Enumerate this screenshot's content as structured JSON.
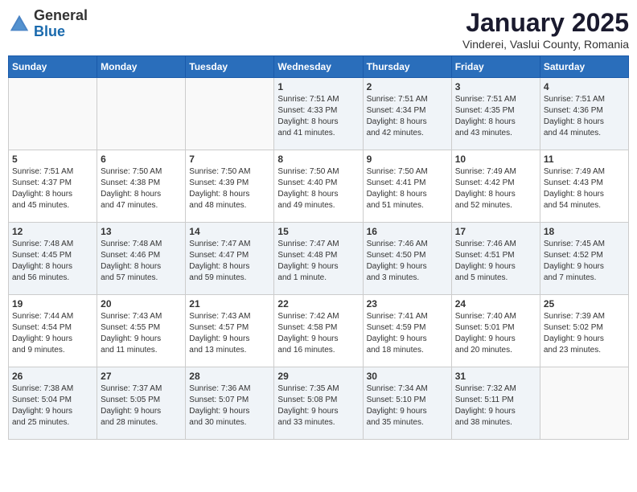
{
  "header": {
    "logo_general": "General",
    "logo_blue": "Blue",
    "title": "January 2025",
    "location": "Vinderei, Vaslui County, Romania"
  },
  "weekdays": [
    "Sunday",
    "Monday",
    "Tuesday",
    "Wednesday",
    "Thursday",
    "Friday",
    "Saturday"
  ],
  "weeks": [
    [
      {
        "day": "",
        "info": ""
      },
      {
        "day": "",
        "info": ""
      },
      {
        "day": "",
        "info": ""
      },
      {
        "day": "1",
        "info": "Sunrise: 7:51 AM\nSunset: 4:33 PM\nDaylight: 8 hours\nand 41 minutes."
      },
      {
        "day": "2",
        "info": "Sunrise: 7:51 AM\nSunset: 4:34 PM\nDaylight: 8 hours\nand 42 minutes."
      },
      {
        "day": "3",
        "info": "Sunrise: 7:51 AM\nSunset: 4:35 PM\nDaylight: 8 hours\nand 43 minutes."
      },
      {
        "day": "4",
        "info": "Sunrise: 7:51 AM\nSunset: 4:36 PM\nDaylight: 8 hours\nand 44 minutes."
      }
    ],
    [
      {
        "day": "5",
        "info": "Sunrise: 7:51 AM\nSunset: 4:37 PM\nDaylight: 8 hours\nand 45 minutes."
      },
      {
        "day": "6",
        "info": "Sunrise: 7:50 AM\nSunset: 4:38 PM\nDaylight: 8 hours\nand 47 minutes."
      },
      {
        "day": "7",
        "info": "Sunrise: 7:50 AM\nSunset: 4:39 PM\nDaylight: 8 hours\nand 48 minutes."
      },
      {
        "day": "8",
        "info": "Sunrise: 7:50 AM\nSunset: 4:40 PM\nDaylight: 8 hours\nand 49 minutes."
      },
      {
        "day": "9",
        "info": "Sunrise: 7:50 AM\nSunset: 4:41 PM\nDaylight: 8 hours\nand 51 minutes."
      },
      {
        "day": "10",
        "info": "Sunrise: 7:49 AM\nSunset: 4:42 PM\nDaylight: 8 hours\nand 52 minutes."
      },
      {
        "day": "11",
        "info": "Sunrise: 7:49 AM\nSunset: 4:43 PM\nDaylight: 8 hours\nand 54 minutes."
      }
    ],
    [
      {
        "day": "12",
        "info": "Sunrise: 7:48 AM\nSunset: 4:45 PM\nDaylight: 8 hours\nand 56 minutes."
      },
      {
        "day": "13",
        "info": "Sunrise: 7:48 AM\nSunset: 4:46 PM\nDaylight: 8 hours\nand 57 minutes."
      },
      {
        "day": "14",
        "info": "Sunrise: 7:47 AM\nSunset: 4:47 PM\nDaylight: 8 hours\nand 59 minutes."
      },
      {
        "day": "15",
        "info": "Sunrise: 7:47 AM\nSunset: 4:48 PM\nDaylight: 9 hours\nand 1 minute."
      },
      {
        "day": "16",
        "info": "Sunrise: 7:46 AM\nSunset: 4:50 PM\nDaylight: 9 hours\nand 3 minutes."
      },
      {
        "day": "17",
        "info": "Sunrise: 7:46 AM\nSunset: 4:51 PM\nDaylight: 9 hours\nand 5 minutes."
      },
      {
        "day": "18",
        "info": "Sunrise: 7:45 AM\nSunset: 4:52 PM\nDaylight: 9 hours\nand 7 minutes."
      }
    ],
    [
      {
        "day": "19",
        "info": "Sunrise: 7:44 AM\nSunset: 4:54 PM\nDaylight: 9 hours\nand 9 minutes."
      },
      {
        "day": "20",
        "info": "Sunrise: 7:43 AM\nSunset: 4:55 PM\nDaylight: 9 hours\nand 11 minutes."
      },
      {
        "day": "21",
        "info": "Sunrise: 7:43 AM\nSunset: 4:57 PM\nDaylight: 9 hours\nand 13 minutes."
      },
      {
        "day": "22",
        "info": "Sunrise: 7:42 AM\nSunset: 4:58 PM\nDaylight: 9 hours\nand 16 minutes."
      },
      {
        "day": "23",
        "info": "Sunrise: 7:41 AM\nSunset: 4:59 PM\nDaylight: 9 hours\nand 18 minutes."
      },
      {
        "day": "24",
        "info": "Sunrise: 7:40 AM\nSunset: 5:01 PM\nDaylight: 9 hours\nand 20 minutes."
      },
      {
        "day": "25",
        "info": "Sunrise: 7:39 AM\nSunset: 5:02 PM\nDaylight: 9 hours\nand 23 minutes."
      }
    ],
    [
      {
        "day": "26",
        "info": "Sunrise: 7:38 AM\nSunset: 5:04 PM\nDaylight: 9 hours\nand 25 minutes."
      },
      {
        "day": "27",
        "info": "Sunrise: 7:37 AM\nSunset: 5:05 PM\nDaylight: 9 hours\nand 28 minutes."
      },
      {
        "day": "28",
        "info": "Sunrise: 7:36 AM\nSunset: 5:07 PM\nDaylight: 9 hours\nand 30 minutes."
      },
      {
        "day": "29",
        "info": "Sunrise: 7:35 AM\nSunset: 5:08 PM\nDaylight: 9 hours\nand 33 minutes."
      },
      {
        "day": "30",
        "info": "Sunrise: 7:34 AM\nSunset: 5:10 PM\nDaylight: 9 hours\nand 35 minutes."
      },
      {
        "day": "31",
        "info": "Sunrise: 7:32 AM\nSunset: 5:11 PM\nDaylight: 9 hours\nand 38 minutes."
      },
      {
        "day": "",
        "info": ""
      }
    ]
  ]
}
